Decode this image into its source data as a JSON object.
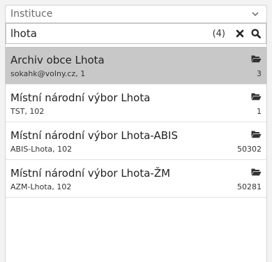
{
  "filter": {
    "label": "Instituce",
    "icon": "chevron-down-icon"
  },
  "search": {
    "value": "lhota",
    "result_count": "(4)",
    "clear_icon": "close-icon",
    "search_icon": "search-icon"
  },
  "results": [
    {
      "title": "Archiv obce Lhota",
      "subtitle": "sokahk@volny.cz, 1",
      "count": "3",
      "icon": "folder-open-icon",
      "selected": true
    },
    {
      "title": "Místní národní výbor Lhota",
      "subtitle": "TST, 102",
      "count": "1",
      "icon": "folder-open-icon",
      "selected": false
    },
    {
      "title": "Místní národní výbor Lhota-ABIS",
      "subtitle": "ABIS-Lhota, 102",
      "count": "50302",
      "icon": "folder-open-icon",
      "selected": false
    },
    {
      "title": "Místní národní výbor Lhota-ŽM",
      "subtitle": "AZM-Lhota, 102",
      "count": "50281",
      "icon": "folder-open-icon",
      "selected": false
    }
  ],
  "colors": {
    "selected_row": "#c8c8c8",
    "panel_bg": "#ffffff",
    "page_bg": "#f3f3f3",
    "border": "#d3d3d3"
  }
}
